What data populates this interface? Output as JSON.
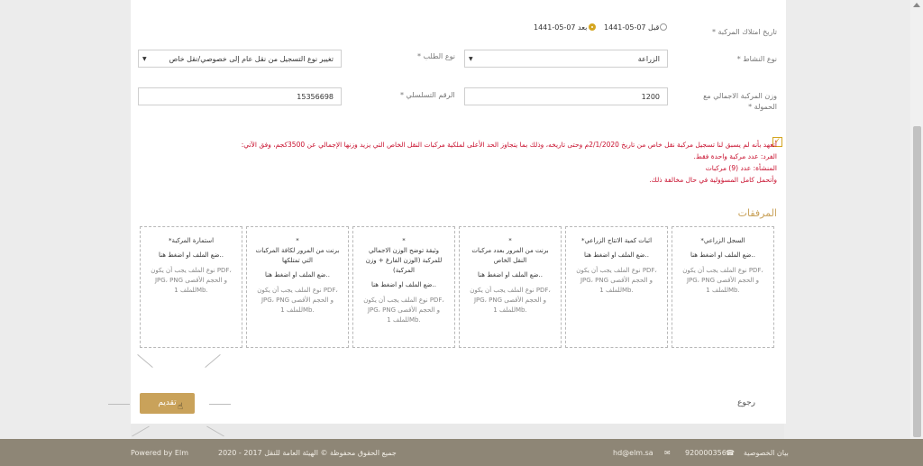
{
  "form": {
    "ownership_date_label": "تاريخ امتلاك المركبة *",
    "radio_before": "قبل 07-05-1441",
    "radio_after": "بعد 07-05-1441",
    "activity_label": "نوع النشاط *",
    "activity_value": "الزراعة",
    "request_type_label": "نوع الطلب *",
    "request_type_value": "تغيير نوع التسجيل من نقل عام إلى خصوصي/نقل خاص",
    "weight_label": "وزن المركبة الاجمالي مع الحمولة *",
    "weight_value": "1200",
    "serial_label": "الرقم التسلسلي *",
    "serial_value": "15356698"
  },
  "pledge": {
    "line1": "أتعهد بأنه لم يسبق لنا تسجيل مركبة نقل خاص من تاريخ 2/1/2020م وحتى تاريخه، وذلك بما يتجاوز الحد الأعلى لملكية مركبات النقل الخاص التي يزيد وزنها الإجمالي عن 3500كجم، وفق الآتي:",
    "line2": "الفرد: عدد مركبة واحدة فقط.",
    "line3": "المنشأة: عدد (9) مركبات",
    "line4": "وأتحمل كامل المسؤولية في حال مخالفة ذلك."
  },
  "attachments": {
    "title": "المرفقات",
    "drop_text": "ضع الملف او اضغط هنا..",
    "hint": "نوع الملف يجب أن يكون PDF، JPG، PNG و الحجم الأقصى للملف 1Mb.",
    "items": [
      "*السجل الزراعي",
      "*اثبات كمية الانتاج الزراعي",
      "*\nبرنت من المرور بعدد مركبات النقل الخاص",
      "*\nوثيقة توضح الوزن الاجمالي للمركبة (الوزن الفارغ + وزن المركبة)",
      "*\nبرنت من المرور لكافة المركبات التي تمتلكها",
      "*استمارة المركبة"
    ]
  },
  "actions": {
    "submit": "تقديم",
    "back": "رجوع"
  },
  "footer": {
    "powered": "Powered by Elm",
    "rights": "جميع الحقوق محفوظة © الهيئة العامة للنقل 2017 - 2020",
    "email": "hd@elm.sa",
    "phone": "920000356",
    "privacy": "بيان الخصوصية"
  },
  "colors": {
    "accent": "#c9a25a",
    "radio_selected": "#d4a520",
    "pledge_text": "#c8102e",
    "footer_bg": "#8e8676"
  }
}
